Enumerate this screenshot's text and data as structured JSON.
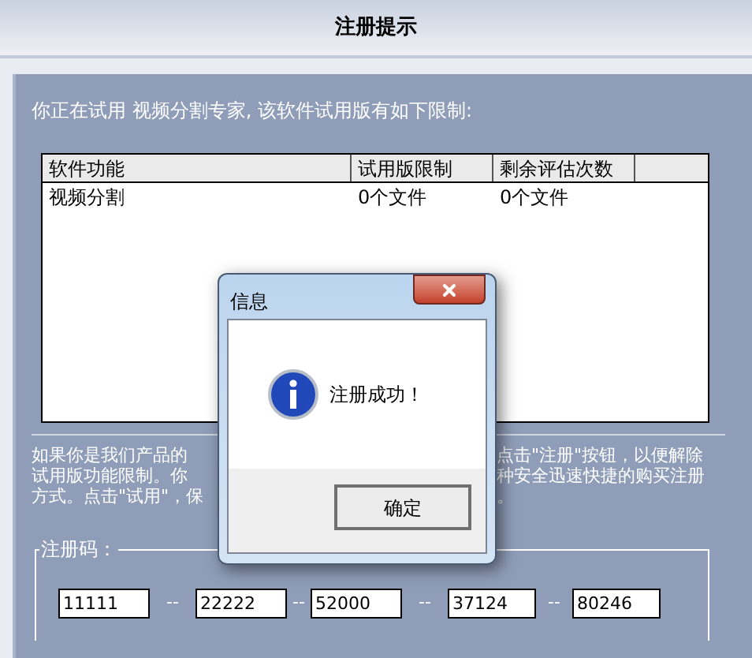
{
  "window": {
    "title": "注册提示"
  },
  "intro": "你正在试用 视频分割专家, 该软件试用版有如下限制:",
  "table": {
    "columns": [
      "软件功能",
      "试用版限制",
      "剩余评估次数"
    ],
    "rows": [
      [
        "视频分割",
        "0个文件",
        "0个文件"
      ]
    ]
  },
  "notice_lines": [
    {
      "left": "如果你是我们产品的",
      "right": "点击\"注册\"按钮，以便解除"
    },
    {
      "left": "试用版功能限制。你",
      "right": "种安全迅速快捷的购买注册"
    },
    {
      "left": "方式。点击\"试用\"，保",
      "right": "。"
    }
  ],
  "code_group": {
    "label": "注册码：",
    "fields": [
      {
        "value": "11111"
      },
      {
        "value": "22222"
      },
      {
        "value": "52000"
      },
      {
        "value": "37124"
      },
      {
        "value": "80246"
      }
    ],
    "separators": [
      "--",
      "--",
      "--",
      "--"
    ]
  },
  "dialog": {
    "title": "信息",
    "message": "注册成功！",
    "button": "确定"
  }
}
